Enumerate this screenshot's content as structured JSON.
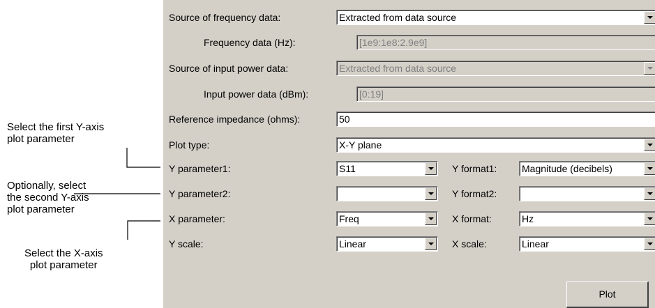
{
  "form": {
    "source_freq_label": "Source of frequency data:",
    "source_freq_value": "Extracted from data source",
    "freq_data_label": "Frequency data (Hz):",
    "freq_data_value": "[1e9:1e8:2.9e9]",
    "source_power_label": "Source of input power data:",
    "source_power_value": "Extracted from data source",
    "power_data_label": "Input power data (dBm):",
    "power_data_value": "[0:19]",
    "ref_imp_label": "Reference impedance (ohms):",
    "ref_imp_value": "50",
    "plot_type_label": "Plot type:",
    "plot_type_value": "X-Y plane",
    "y_param1_label": "Y parameter1:",
    "y_param1_value": "S11",
    "y_format1_label": "Y format1:",
    "y_format1_value": "Magnitude (decibels)",
    "y_param2_label": "Y parameter2:",
    "y_param2_value": "",
    "y_format2_label": "Y format2:",
    "y_format2_value": "",
    "x_param_label": "X parameter:",
    "x_param_value": "Freq",
    "x_format_label": "X format:",
    "x_format_value": "Hz",
    "y_scale_label": "Y scale:",
    "y_scale_value": "Linear",
    "x_scale_label": "X scale:",
    "x_scale_value": "Linear",
    "plot_button": "Plot"
  },
  "annotations": {
    "first_y": [
      "Select the first Y-axis",
      "plot parameter"
    ],
    "second_y": [
      "Optionally, select",
      "the second Y-axis",
      "plot parameter"
    ],
    "x_axis": [
      "Select the X-axis",
      "plot parameter"
    ]
  }
}
